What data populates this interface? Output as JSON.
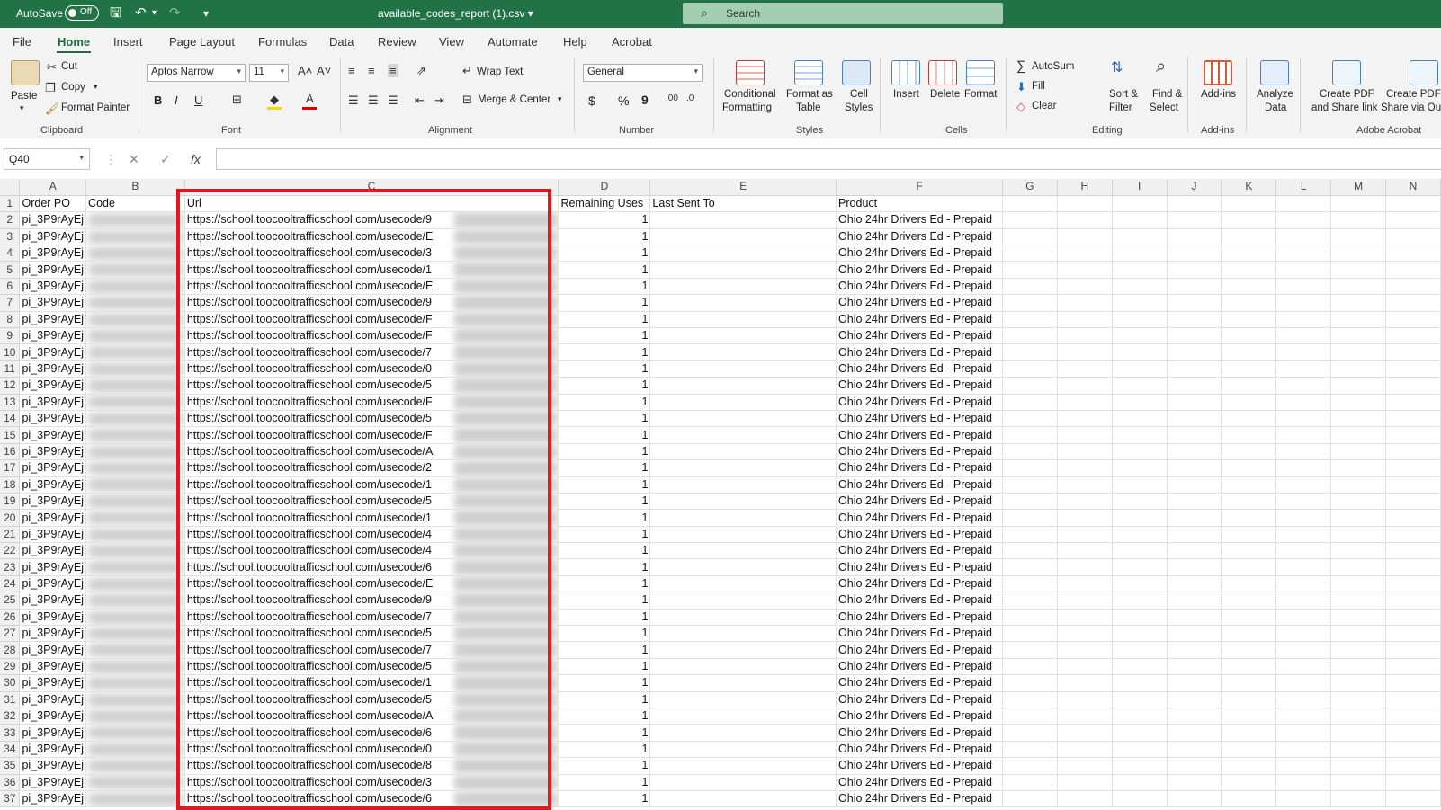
{
  "titlebar": {
    "autosave_label": "AutoSave",
    "autosave_state": "Off",
    "filename": "available_codes_report (1).csv",
    "search_placeholder": "Search",
    "bg_color": "#217346"
  },
  "tabs": [
    "File",
    "Home",
    "Insert",
    "Page Layout",
    "Formulas",
    "Data",
    "Review",
    "View",
    "Automate",
    "Help",
    "Acrobat"
  ],
  "active_tab": "Home",
  "ribbon": {
    "clipboard": {
      "paste": "Paste",
      "cut": "Cut",
      "copy": "Copy",
      "format_painter": "Format Painter",
      "group": "Clipboard"
    },
    "font": {
      "family": "Aptos Narrow",
      "size": "11",
      "bold": "B",
      "italic": "I",
      "underline": "U",
      "group": "Font"
    },
    "alignment": {
      "wrap_text": "Wrap Text",
      "merge_center": "Merge & Center",
      "group": "Alignment"
    },
    "number": {
      "format": "General",
      "currency": "$",
      "percent": "%",
      "comma": "9",
      "group": "Number"
    },
    "styles": {
      "conditional_1": "Conditional",
      "conditional_2": "Formatting",
      "format_table_1": "Format as",
      "format_table_2": "Table",
      "cell_styles_1": "Cell",
      "cell_styles_2": "Styles",
      "group": "Styles"
    },
    "cells": {
      "insert": "Insert",
      "delete": "Delete",
      "format": "Format",
      "group": "Cells"
    },
    "editing": {
      "autosum": "AutoSum",
      "fill": "Fill",
      "clear": "Clear",
      "sort_1": "Sort &",
      "sort_2": "Filter",
      "find_1": "Find &",
      "find_2": "Select",
      "group": "Editing"
    },
    "addins": {
      "label": "Add-ins",
      "group": "Add-ins"
    },
    "analyze": {
      "label_1": "Analyze",
      "label_2": "Data"
    },
    "acrobat": {
      "create_pdf_1": "Create PDF",
      "create_pdf_2": "and Share link",
      "create_via_1": "Create PDF a",
      "create_via_2": "Share via Out",
      "group": "Adobe Acrobat"
    }
  },
  "formula_bar": {
    "name_box": "Q40",
    "fx": "fx",
    "cancel": "✕",
    "enter": "✓"
  },
  "sheet": {
    "column_letters": [
      "A",
      "B",
      "C",
      "D",
      "E",
      "F",
      "G",
      "H",
      "I",
      "J",
      "K",
      "L",
      "M",
      "N"
    ],
    "headers": [
      "Order PO",
      "Code",
      "Url",
      "Remaining Uses",
      "Last Sent To",
      "Product"
    ],
    "order_po_value": "pi_3P9rAyEj",
    "url_prefix": "https://school.toocooltrafficschool.com/usecode/",
    "url_first_chars": [
      "9",
      "E",
      "3",
      "1",
      "E",
      "9",
      "F",
      "F",
      "7",
      "0",
      "5",
      "F",
      "5",
      "F",
      "A",
      "2",
      "1",
      "5",
      "1",
      "4",
      "4",
      "6",
      "E",
      "9",
      "7",
      "5",
      "7",
      "5",
      "1",
      "5",
      "A",
      "6",
      "0",
      "8",
      "3",
      "6"
    ],
    "remaining_uses": "1",
    "product": "Ohio 24hr Drivers Ed - Prepaid",
    "row_count": 37
  },
  "highlight_color": "#e8151b"
}
